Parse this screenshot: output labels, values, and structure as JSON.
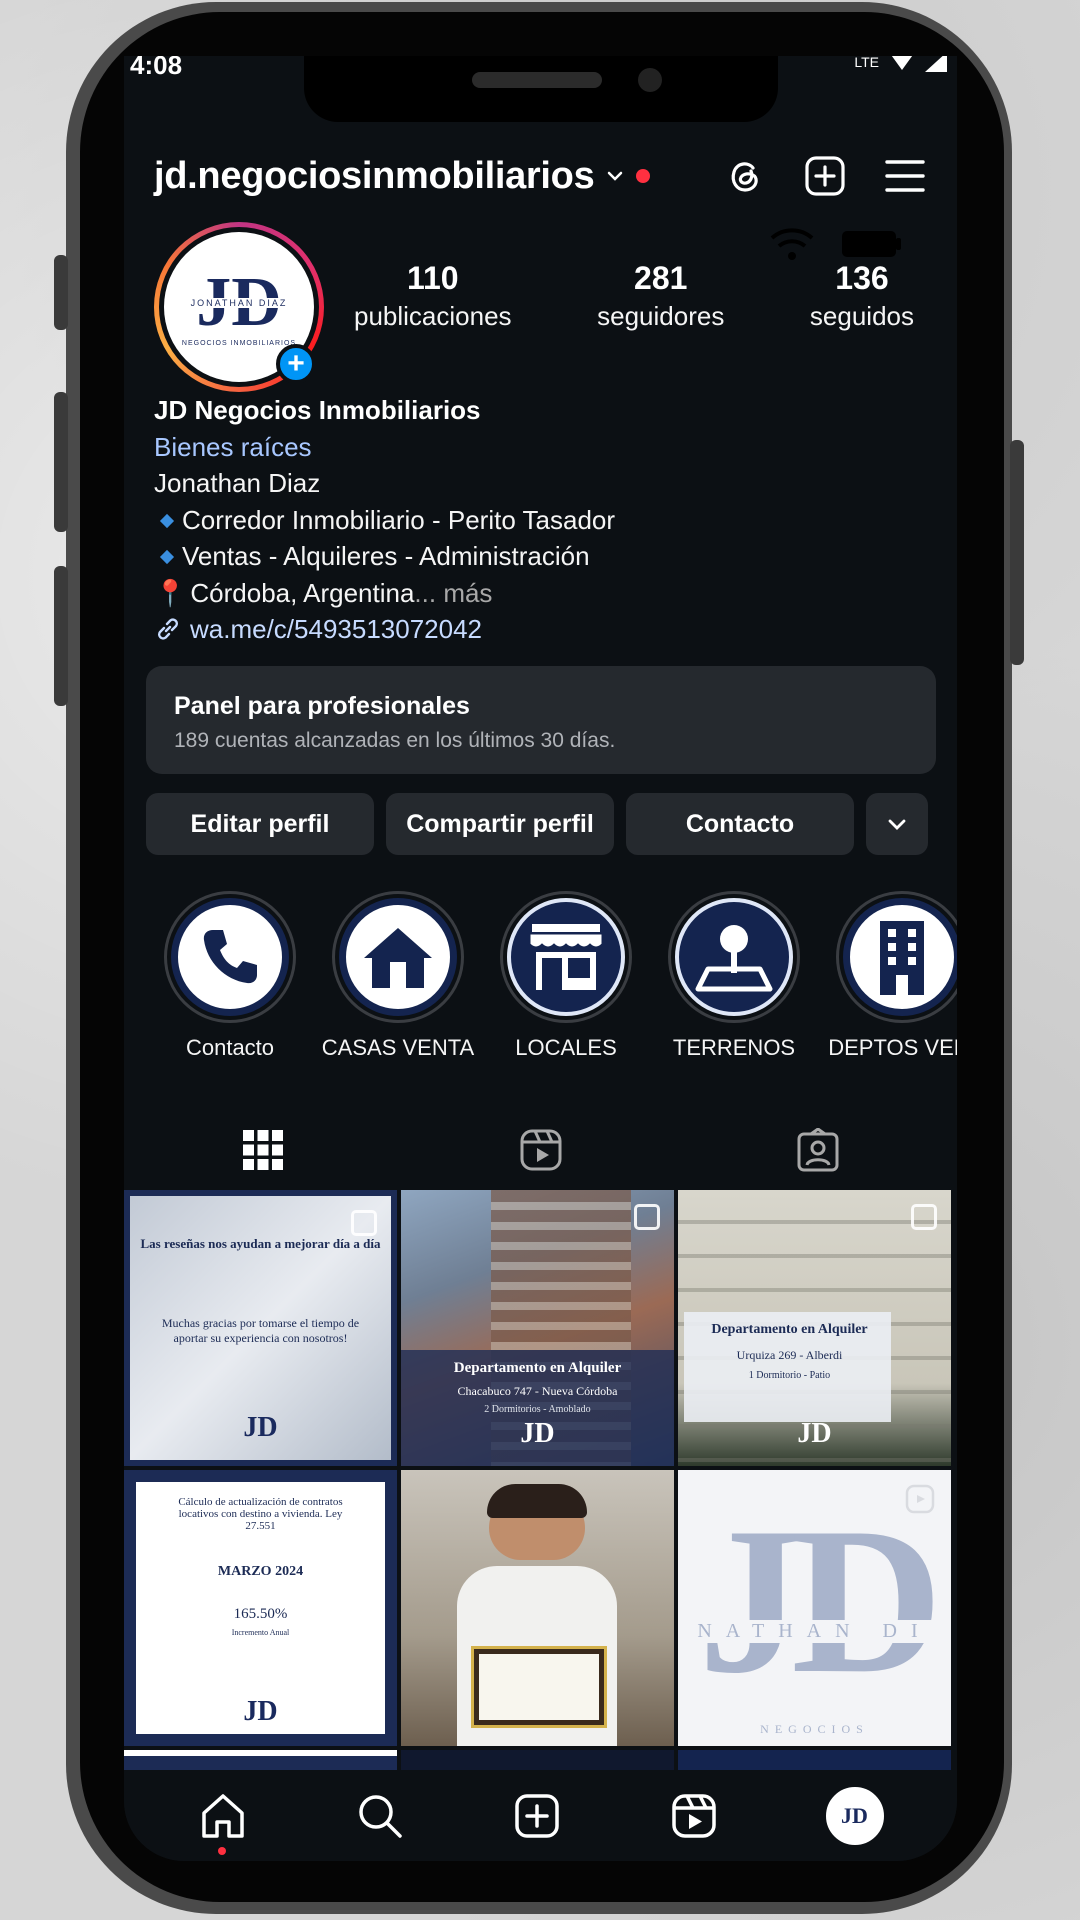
{
  "status_bar": {
    "time": "4:08",
    "network": "LTE"
  },
  "header": {
    "username": "jd.negociosinmobiliarios"
  },
  "profile": {
    "avatar_text": "JD",
    "avatar_name": "JONATHAN DIAZ",
    "avatar_sub": "NEGOCIOS INMOBILIARIOS",
    "stats": [
      {
        "value": "110",
        "label": "publicaciones"
      },
      {
        "value": "281",
        "label": "seguidores"
      },
      {
        "value": "136",
        "label": "seguidos"
      }
    ]
  },
  "bio": {
    "name": "JD Negocios Inmobiliarios",
    "category": "Bienes raíces",
    "line1": "Jonathan Diaz",
    "line2": "Corredor Inmobiliario - Perito Tasador",
    "line3": "Ventas - Alquileres - Administración",
    "line4": "Córdoba, Argentina",
    "more": "... más",
    "link": "wa.me/c/5493513072042"
  },
  "panel": {
    "title": "Panel para profesionales",
    "subtitle": "189 cuentas alcanzadas en los últimos 30 días."
  },
  "actions": {
    "edit": "Editar perfil",
    "share": "Compartir perfil",
    "contact": "Contacto"
  },
  "highlights": [
    {
      "label": "Contacto",
      "icon": "phone-icon"
    },
    {
      "label": "CASAS VENTA",
      "icon": "house-icon"
    },
    {
      "label": "LOCALES",
      "icon": "storefront-icon"
    },
    {
      "label": "TERRENOS",
      "icon": "land-plot-icon"
    },
    {
      "label": "DEPTOS VEN.",
      "icon": "building-icon"
    }
  ],
  "posts": [
    {
      "title": "Las reseñas nos ayudan a mejorar día a día",
      "body": "Muchas gracias por tomarse el tiempo de aportar su experiencia con nosotros!",
      "logo": "JD"
    },
    {
      "title": "Departamento en Alquiler",
      "body": "Chacabuco 747 - Nueva Córdoba",
      "extra": "2 Dormitorios - Amoblado",
      "logo": "JD"
    },
    {
      "title": "Departamento en Alquiler",
      "body": "Urquiza 269 - Alberdi",
      "extra": "1 Dormitorio - Patio",
      "logo": "JD"
    },
    {
      "title": "Cálculo de actualización de contratos locativos con destino a vivienda. Ley 27.551",
      "body": "MARZO 2024",
      "value": "165.50%",
      "extra": "Incremento Anual",
      "logo": "JD"
    },
    {
      "title": ""
    },
    {
      "title": "JD",
      "body": "NATHAN DI",
      "extra": "NEGOCIOS"
    }
  ],
  "colors": {
    "background": "#0c1014",
    "accent": "#0095f6",
    "link": "#a8c7ff",
    "live": "#ff3040",
    "brand_navy": "#1a2a5e"
  }
}
